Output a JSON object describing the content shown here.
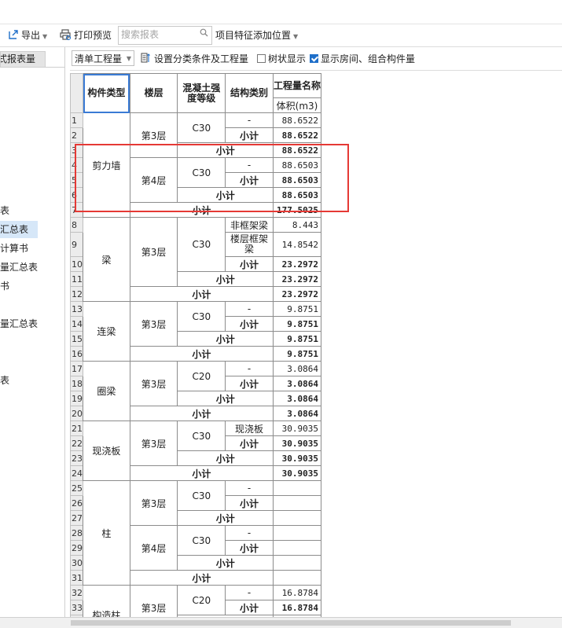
{
  "toolbar": {
    "export_label": "导出",
    "print_preview_label": "打印预览",
    "search_placeholder": "搜索报表",
    "feature_position_label": "项目特征添加位置"
  },
  "sidebar": {
    "tab_label": "式报表量",
    "items": [
      {
        "label": "表",
        "selected": false
      },
      {
        "label": "汇总表",
        "selected": true
      },
      {
        "label": "计算书",
        "selected": false
      },
      {
        "label": "量汇总表",
        "selected": false
      },
      {
        "label": "书",
        "selected": false
      },
      {
        "label": "量汇总表",
        "selected": false
      },
      {
        "label": "表",
        "selected": false
      }
    ]
  },
  "options": {
    "scope_select": "清单工程量",
    "set_conditions_label": "设置分类条件及工程量",
    "tree_view_label": "树状显示",
    "tree_view_checked": false,
    "show_rooms_label": "显示房间、组合构件量",
    "show_rooms_checked": true
  },
  "table": {
    "headers": {
      "component_type": "构件类型",
      "floor": "楼层",
      "concrete_grade": "混凝土强度等级",
      "structure_type": "结构类别",
      "quantity_name": "工程量名称",
      "volume": "体积(m3)"
    },
    "subtotal_label": "小计",
    "row_numbers": [
      "1",
      "2",
      "3",
      "4",
      "5",
      "6",
      "7",
      "8",
      "9",
      "10",
      "11",
      "12",
      "13",
      "14",
      "15",
      "16",
      "17",
      "18",
      "19",
      "20",
      "21",
      "22",
      "23",
      "24",
      "25",
      "26",
      "27",
      "28",
      "29",
      "30",
      "31",
      "32",
      "33"
    ],
    "groups": [
      {
        "type": "剪力墙",
        "total": "177.5025",
        "floors": [
          {
            "floor": "第3层",
            "grade": "C30",
            "subtotal": "88.6522",
            "items": [
              {
                "struct": "-",
                "value": "88.6522"
              }
            ],
            "grade_subtotal": "88.6522"
          },
          {
            "floor": "第4层",
            "grade": "C30",
            "subtotal": "88.6503",
            "items": [
              {
                "struct": "-",
                "value": "88.6503"
              }
            ],
            "grade_subtotal": "88.6503"
          }
        ]
      },
      {
        "type": "梁",
        "total": "23.2972",
        "floors": [
          {
            "floor": "第3层",
            "grade": "C30",
            "subtotal": "23.2972",
            "items": [
              {
                "struct": "非框架梁",
                "value": "8.443"
              },
              {
                "struct": "楼层框架梁",
                "value": "14.8542"
              }
            ],
            "grade_subtotal": "23.2972"
          }
        ]
      },
      {
        "type": "连梁",
        "total": "9.8751",
        "floors": [
          {
            "floor": "第3层",
            "grade": "C30",
            "subtotal": "9.8751",
            "items": [
              {
                "struct": "-",
                "value": "9.8751"
              }
            ],
            "grade_subtotal": "9.8751"
          }
        ]
      },
      {
        "type": "圈梁",
        "total": "3.0864",
        "floors": [
          {
            "floor": "第3层",
            "grade": "C20",
            "subtotal": "3.0864",
            "items": [
              {
                "struct": "-",
                "value": "3.0864"
              }
            ],
            "grade_subtotal": "3.0864"
          }
        ]
      },
      {
        "type": "现浇板",
        "total": "30.9035",
        "floors": [
          {
            "floor": "第3层",
            "grade": "C30",
            "subtotal": "30.9035",
            "items": [
              {
                "struct": "现浇板",
                "value": "30.9035"
              }
            ],
            "grade_subtotal": "30.9035"
          }
        ]
      },
      {
        "type": "柱",
        "total": "",
        "floors": [
          {
            "floor": "第3层",
            "grade": "C30",
            "subtotal": "",
            "items": [
              {
                "struct": "-",
                "value": ""
              }
            ],
            "grade_subtotal": ""
          },
          {
            "floor": "第4层",
            "grade": "C30",
            "subtotal": "",
            "items": [
              {
                "struct": "-",
                "value": ""
              }
            ],
            "grade_subtotal": ""
          }
        ]
      },
      {
        "type": "构造柱",
        "total": "",
        "floors": [
          {
            "floor": "第3层",
            "grade": "C20",
            "subtotal": "16.8784",
            "items": [
              {
                "struct": "-",
                "value": "16.8784"
              }
            ],
            "grade_subtotal": "16.8784"
          }
        ]
      }
    ]
  }
}
